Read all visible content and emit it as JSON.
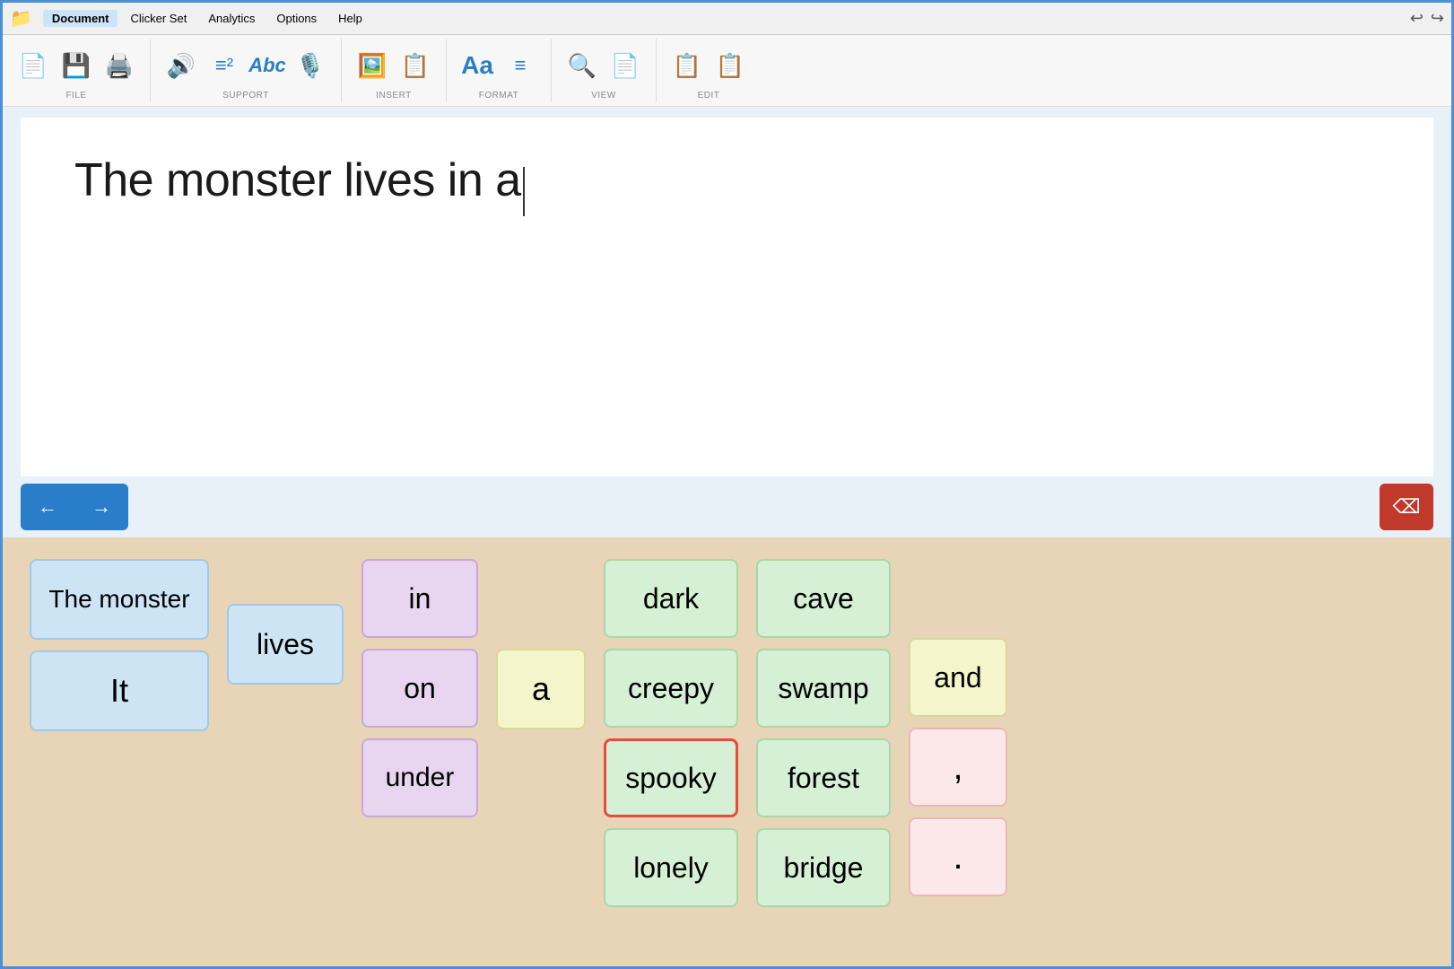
{
  "titleBar": {
    "folderIcon": "📁",
    "tabs": [
      {
        "label": "Document",
        "active": true
      },
      {
        "label": "Clicker Set",
        "active": false
      },
      {
        "label": "Analytics",
        "active": false
      },
      {
        "label": "Options",
        "active": false
      },
      {
        "label": "Help",
        "active": false
      }
    ],
    "undoIcon": "↩",
    "redoIcon": "↪"
  },
  "toolbar": {
    "groups": [
      {
        "label": "FILE",
        "buttons": [
          "📄",
          "💾",
          "🖨️"
        ]
      },
      {
        "label": "SUPPORT",
        "buttons": [
          "🔊",
          "≡²",
          "Abc",
          "🎙️"
        ]
      },
      {
        "label": "INSERT",
        "buttons": [
          "🖼️",
          "📋"
        ]
      },
      {
        "label": "FORMAT",
        "buttons": [
          "Aa",
          "≡"
        ]
      },
      {
        "label": "VIEW",
        "buttons": [
          "🔍",
          "📄"
        ]
      },
      {
        "label": "EDIT",
        "buttons": [
          "📋",
          "📋"
        ]
      }
    ]
  },
  "document": {
    "text": "The monster lives in a"
  },
  "navigation": {
    "backLabel": "←",
    "forwardLabel": "→",
    "deleteLabel": "⌫"
  },
  "wordBoard": {
    "columns": [
      {
        "id": "subjects",
        "tiles": [
          {
            "text": "The monster",
            "color": "blue"
          },
          {
            "text": "It",
            "color": "blue"
          }
        ]
      },
      {
        "id": "verbs",
        "tiles": [
          {
            "text": "lives",
            "color": "blue"
          }
        ]
      },
      {
        "id": "prepositions",
        "tiles": [
          {
            "text": "in",
            "color": "purple"
          },
          {
            "text": "on",
            "color": "purple"
          },
          {
            "text": "under",
            "color": "purple"
          }
        ]
      },
      {
        "id": "articles",
        "tiles": [
          {
            "text": "a",
            "color": "yellow"
          }
        ]
      },
      {
        "id": "adjectives",
        "tiles": [
          {
            "text": "dark",
            "color": "green"
          },
          {
            "text": "creepy",
            "color": "green"
          },
          {
            "text": "spooky",
            "color": "green",
            "selected": true
          },
          {
            "text": "lonely",
            "color": "green"
          }
        ]
      },
      {
        "id": "nouns",
        "tiles": [
          {
            "text": "cave",
            "color": "green"
          },
          {
            "text": "swamp",
            "color": "green"
          },
          {
            "text": "forest",
            "color": "green"
          },
          {
            "text": "bridge",
            "color": "green"
          }
        ]
      },
      {
        "id": "punctuation",
        "tiles": [
          {
            "text": "and",
            "color": "yellow"
          },
          {
            "text": ",",
            "color": "pink"
          },
          {
            "text": ".",
            "color": "pink"
          }
        ]
      }
    ]
  }
}
